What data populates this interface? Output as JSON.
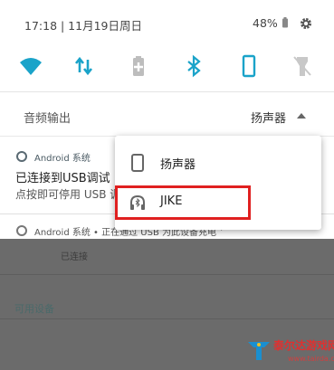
{
  "status_bar": {
    "time_date": "17:18 | 11月19日周日",
    "battery": "48%"
  },
  "quick_settings": {
    "tiles": [
      "wifi-icon",
      "mobile-data-icon",
      "battery-saver-icon",
      "bluetooth-icon",
      "auto-rotate-icon",
      "flashlight-icon"
    ],
    "accent": "#1aa3c9"
  },
  "audio_output": {
    "label": "音频输出",
    "value": "扬声器"
  },
  "notification_usb_debug": {
    "app": "Android 系统",
    "title": "已连接到USB调试",
    "text": "点按即可停用 USB 调"
  },
  "notification_charging": {
    "text": "Android 系统 • 正在通过 USB 为此设备充电 ˅"
  },
  "popup": {
    "items": [
      {
        "label": "扬声器",
        "icon": "phone-speaker-icon"
      },
      {
        "label": "JIKE",
        "icon": "headphone-bluetooth-icon",
        "highlighted": true
      }
    ],
    "highlight_color": "#e02020"
  },
  "background_page": {
    "connected_text": "已连接",
    "available_devices": "可用设备"
  },
  "watermark": {
    "name": "泰尔达游戏网",
    "url": "www.tairda.com"
  }
}
